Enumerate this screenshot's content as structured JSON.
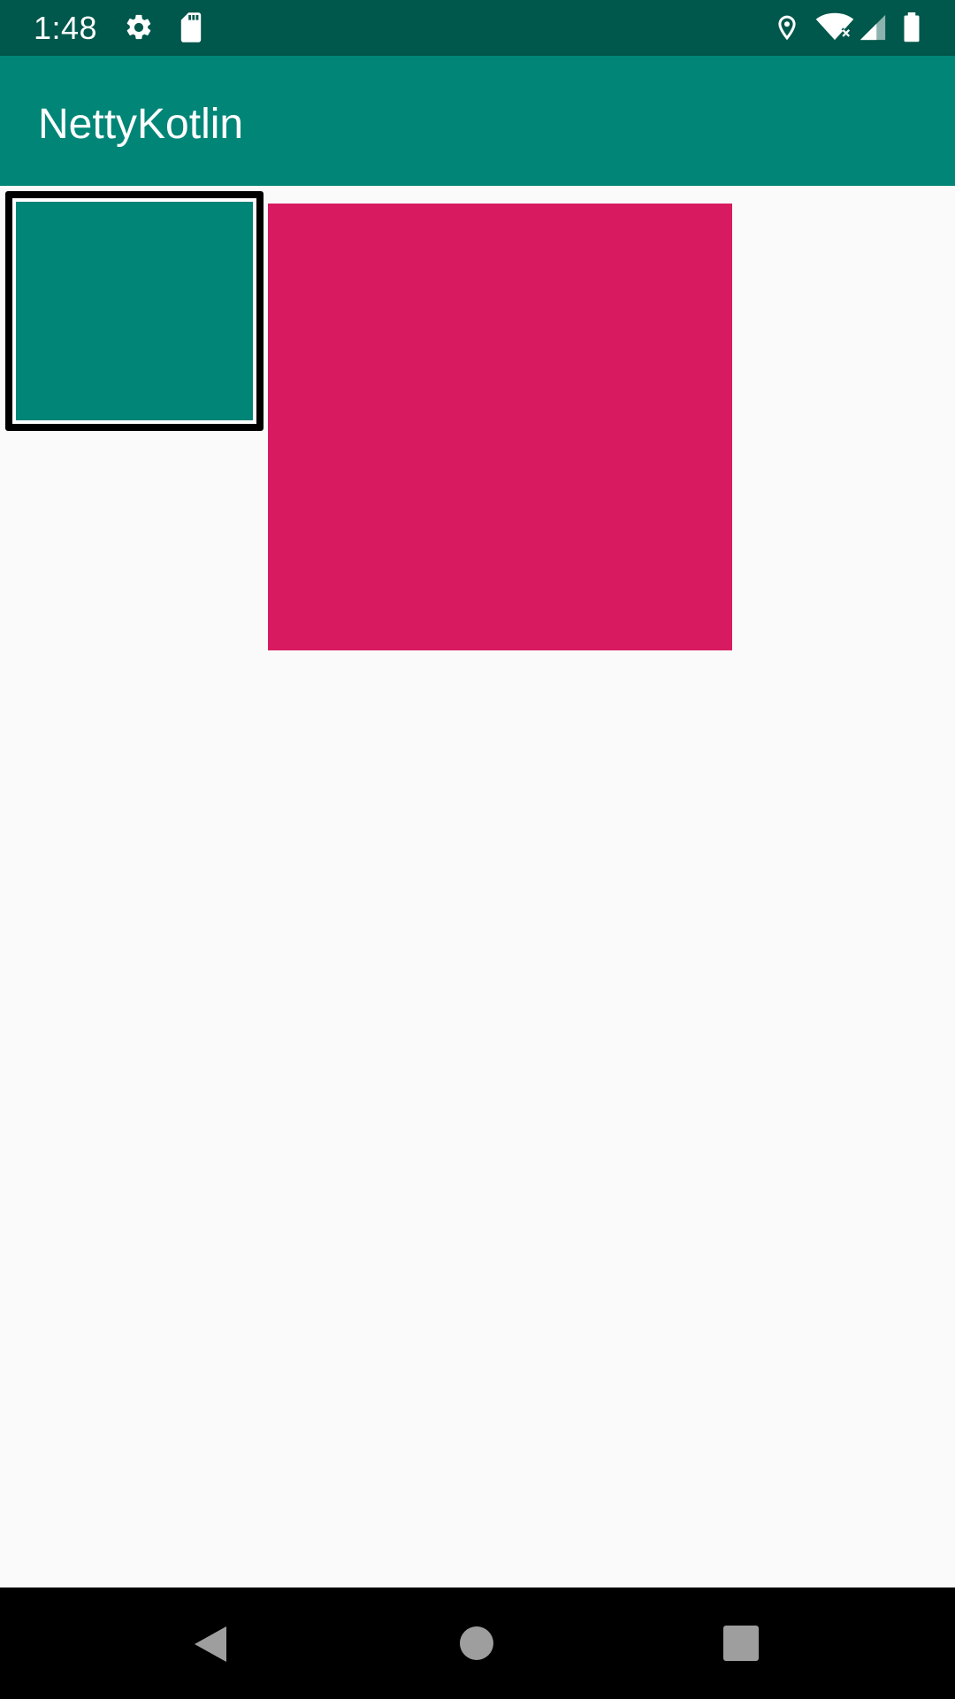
{
  "status_bar": {
    "time": "1:48",
    "icons": [
      "gear-icon",
      "sd-card-icon",
      "location-icon",
      "wifi-icon",
      "signal-icon",
      "battery-icon"
    ]
  },
  "app_bar": {
    "title": "NettyKotlin"
  },
  "content": {
    "items": [
      {
        "name": "teal-box",
        "color": "#008577",
        "selected": true
      },
      {
        "name": "pink-box",
        "color": "#D81B60",
        "selected": false
      }
    ]
  },
  "nav_bar": {
    "icons": [
      "back-icon",
      "home-icon",
      "recents-icon"
    ]
  },
  "colors": {
    "status_bar": "#00574B",
    "primary": "#008577",
    "accent": "#D81B60",
    "background": "#FAFAFA"
  }
}
